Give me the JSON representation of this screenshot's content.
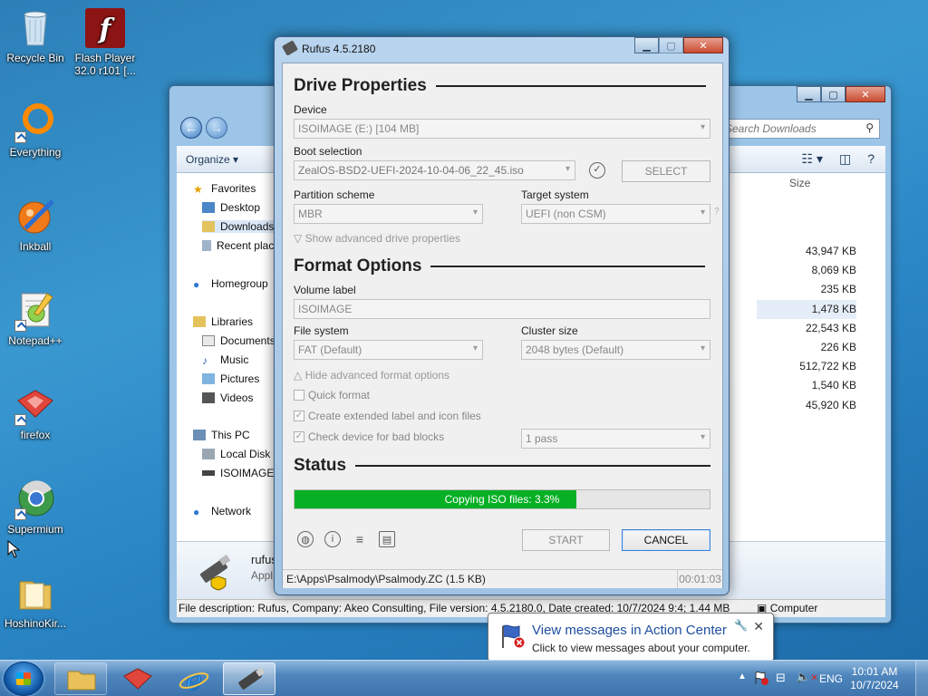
{
  "desktop": {
    "icons": [
      {
        "label": "Recycle Bin",
        "icon": "recycle-bin-icon"
      },
      {
        "label": "Flash Player 32.0 r101 [...",
        "icon": "flash-player-icon"
      },
      {
        "label": "Everything",
        "icon": "everything-icon"
      },
      {
        "label": "Inkball",
        "icon": "inkball-icon"
      },
      {
        "label": "Notepad++",
        "icon": "notepad-plus-plus-icon"
      },
      {
        "label": "firefox",
        "icon": "firefox-icon"
      },
      {
        "label": "Supermium",
        "icon": "supermium-icon"
      },
      {
        "label": "HoshinoKir...",
        "icon": "folder-icon"
      }
    ]
  },
  "explorer": {
    "search_placeholder": "Search Downloads",
    "organize_label": "Organize",
    "size_header": "Size",
    "nav": {
      "favorites": "Favorites",
      "desktop": "Desktop",
      "downloads": "Downloads",
      "recent": "Recent places",
      "homegroup": "Homegroup",
      "libraries": "Libraries",
      "documents": "Documents",
      "music": "Music",
      "pictures": "Pictures",
      "videos": "Videos",
      "thispc": "This PC",
      "localdisk": "Local Disk",
      "isoimage": "ISOIMAGE",
      "network": "Network"
    },
    "sizes": [
      "43,947 KB",
      "8,069 KB",
      "235 KB",
      "1,478 KB",
      "22,543 KB",
      "226 KB",
      "512,722 KB",
      "1,540 KB",
      "45,920 KB"
    ],
    "details_name": "rufus",
    "details_type": "Appl",
    "status_text": "File description: Rufus, Company: Akeo Consulting, File version: 4.5.2180.0, Date created: 10/7/2024 9:4; 1.44 MB",
    "status_location": "Computer"
  },
  "rufus": {
    "title": "Rufus 4.5.2180",
    "drive_properties": "Drive Properties",
    "device_label": "Device",
    "device_value": "ISOIMAGE (E:) [104 MB]",
    "boot_label": "Boot selection",
    "boot_value": "ZealOS-BSD2-UEFI-2024-10-04-06_22_45.iso",
    "select_button": "SELECT",
    "partition_label": "Partition scheme",
    "partition_value": "MBR",
    "target_label": "Target system",
    "target_value": "UEFI (non CSM)",
    "show_advanced": "Show advanced drive properties",
    "format_options": "Format Options",
    "volume_label_label": "Volume label",
    "volume_label_value": "ISOIMAGE",
    "filesystem_label": "File system",
    "filesystem_value": "FAT (Default)",
    "cluster_label": "Cluster size",
    "cluster_value": "2048 bytes (Default)",
    "hide_advanced": "Hide advanced format options",
    "quick_format": "Quick format",
    "extended_label": "Create extended label and icon files",
    "check_bad_blocks": "Check device for bad blocks",
    "passes_value": "1 pass",
    "status_heading": "Status",
    "progress_text": "Copying ISO files: 3.3%",
    "progress_fraction": 0.68,
    "start_button": "START",
    "cancel_button": "CANCEL",
    "status_file": "E:\\Apps\\Psalmody\\Psalmody.ZC (1.5 KB)",
    "timer": "00:01:03"
  },
  "balloon": {
    "title": "View messages in Action Center",
    "subtitle": "Click to view messages about your computer."
  },
  "taskbar": {
    "lang": "ENG",
    "time": "10:01 AM",
    "date": "10/7/2024"
  }
}
